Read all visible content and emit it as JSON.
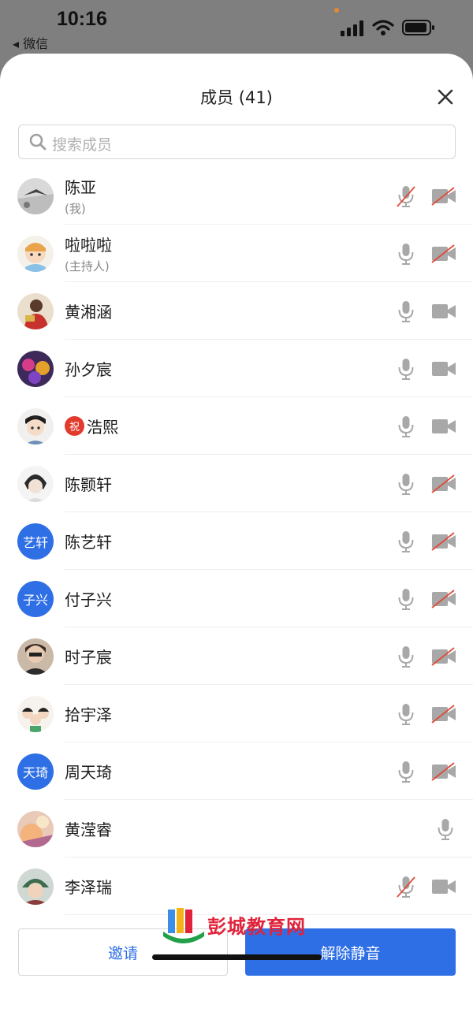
{
  "status": {
    "time": "10:16",
    "back_app": "◂ 微信"
  },
  "header": {
    "title": "成员 (41)"
  },
  "search": {
    "placeholder": "搜索成员"
  },
  "members": [
    {
      "name": "陈亚",
      "role": "(我)",
      "avatar": "photo",
      "mic": "muted",
      "cam": "off"
    },
    {
      "name": "啦啦啦",
      "role": "(主持人)",
      "avatar": "photo",
      "mic": "on",
      "cam": "off"
    },
    {
      "name": "黄湘涵",
      "avatar": "photo",
      "mic": "on",
      "cam": "on"
    },
    {
      "name": "孙夕宸",
      "avatar": "photo",
      "mic": "on",
      "cam": "on"
    },
    {
      "name": "浩熙",
      "badge": "祝",
      "avatar": "photo",
      "mic": "on",
      "cam": "on"
    },
    {
      "name": "陈颢轩",
      "avatar": "photo",
      "mic": "on",
      "cam": "off"
    },
    {
      "name": "陈艺轩",
      "avatar_text": "艺轩",
      "mic": "on",
      "cam": "off"
    },
    {
      "name": "付子兴",
      "avatar_text": "子兴",
      "mic": "on",
      "cam": "off"
    },
    {
      "name": "时子宸",
      "avatar": "photo",
      "mic": "on",
      "cam": "off"
    },
    {
      "name": "拾宇泽",
      "avatar": "photo",
      "mic": "on",
      "cam": "off"
    },
    {
      "name": "周天琦",
      "avatar_text": "天琦",
      "mic": "on",
      "cam": "off"
    },
    {
      "name": "黄滢睿",
      "avatar": "photo",
      "mic": "on",
      "cam": "none"
    },
    {
      "name": "李泽瑞",
      "avatar": "photo",
      "mic": "muted",
      "cam": "on"
    }
  ],
  "footer": {
    "invite_label": "邀请",
    "unmute_label": "解除静音"
  },
  "watermark": {
    "text": "彭城教育网"
  },
  "colors": {
    "accent": "#2f6fe6",
    "muted_red": "#e04a3a",
    "icon_gray": "#a8a8a8"
  }
}
